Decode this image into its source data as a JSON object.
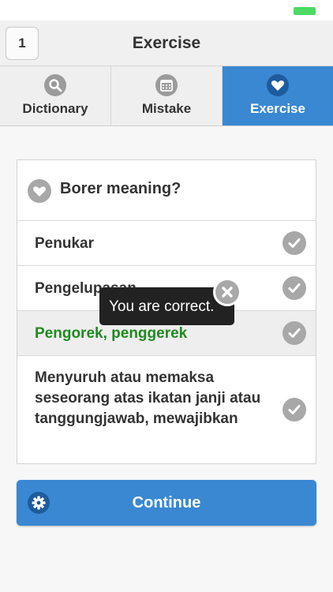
{
  "status_bar": {
    "battery_color": "#4cd964"
  },
  "navbar": {
    "badge": "1",
    "title": "Exercise"
  },
  "tabs": [
    {
      "label": "Dictionary",
      "icon": "search-icon",
      "active": false
    },
    {
      "label": "Mistake",
      "icon": "calendar-icon",
      "active": false
    },
    {
      "label": "Exercise",
      "icon": "heart-icon",
      "active": true
    }
  ],
  "question": {
    "text": "Borer meaning?",
    "icon": "heart-icon"
  },
  "options": [
    {
      "text": "Penukar",
      "correct": false
    },
    {
      "text": "Pengelupasan",
      "correct": false
    },
    {
      "text": "Pengorek, penggerek",
      "correct": true
    },
    {
      "text": "Menyuruh atau memaksa seseorang atas ikatan janji atau tanggungjawab, mewajibkan",
      "correct": false
    }
  ],
  "toast": {
    "text": "You are correct."
  },
  "continue_button": {
    "label": "Continue"
  },
  "colors": {
    "accent": "#3a88d2",
    "accent_dark": "#1d5c9c",
    "correct_text": "#1f8a1f"
  }
}
